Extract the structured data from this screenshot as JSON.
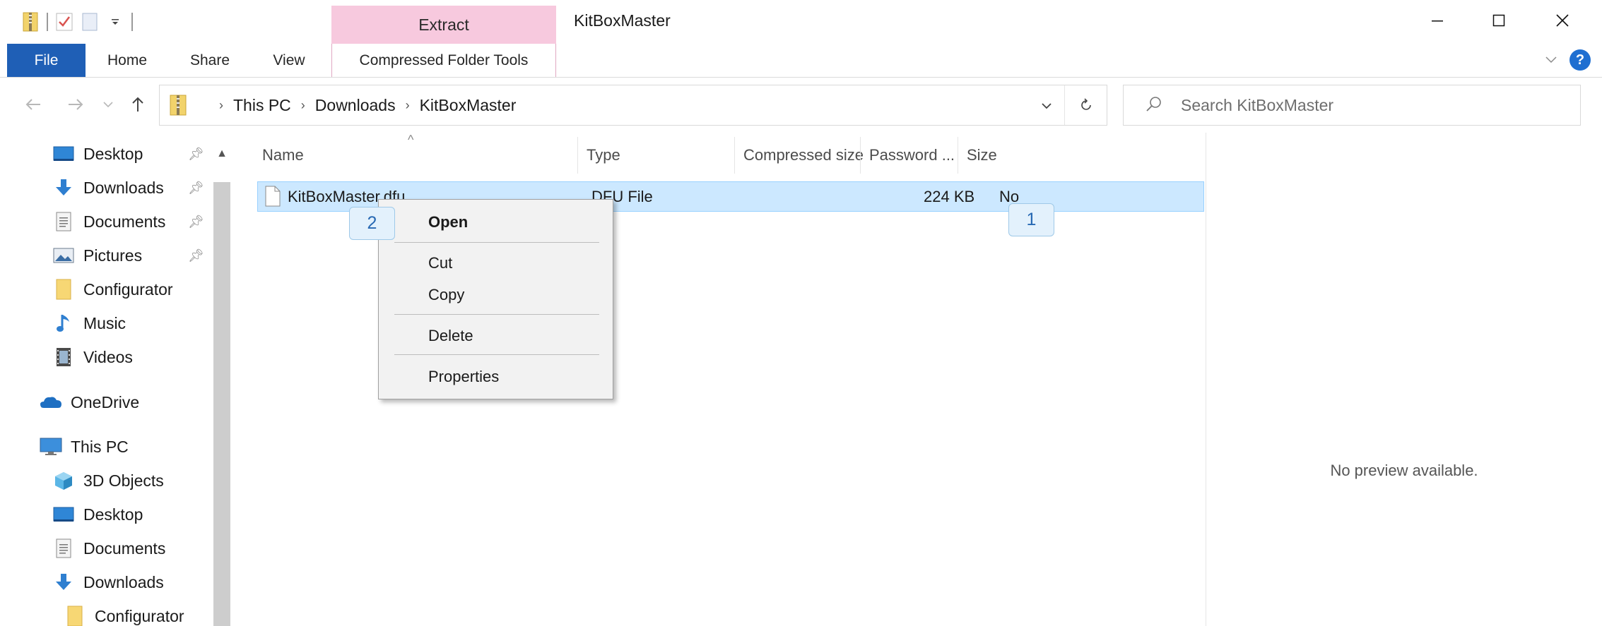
{
  "window": {
    "title": "KitBoxMaster",
    "contextual_tab_header": "Extract",
    "controls": {
      "minimize": "—",
      "maximize": "☐",
      "close": "✕"
    }
  },
  "ribbon": {
    "tabs": [
      {
        "label": "File"
      },
      {
        "label": "Home"
      },
      {
        "label": "Share"
      },
      {
        "label": "View"
      },
      {
        "label": "Compressed Folder Tools"
      }
    ],
    "help": "?"
  },
  "address": {
    "crumbs": [
      "This PC",
      "Downloads",
      "KitBoxMaster"
    ],
    "search_placeholder": "Search KitBoxMaster"
  },
  "nav_pane": {
    "quick_access": [
      {
        "label": "Desktop",
        "icon": "desktop-icon",
        "pinned": true
      },
      {
        "label": "Downloads",
        "icon": "downloads-icon",
        "pinned": true
      },
      {
        "label": "Documents",
        "icon": "documents-icon",
        "pinned": true
      },
      {
        "label": "Pictures",
        "icon": "pictures-icon",
        "pinned": true
      },
      {
        "label": "Configurator",
        "icon": "folder-icon",
        "pinned": false
      },
      {
        "label": "Music",
        "icon": "music-icon",
        "pinned": false
      },
      {
        "label": "Videos",
        "icon": "videos-icon",
        "pinned": false
      }
    ],
    "onedrive": "OneDrive",
    "this_pc": "This PC",
    "this_pc_children": [
      {
        "label": "3D Objects",
        "icon": "3d-objects-icon"
      },
      {
        "label": "Desktop",
        "icon": "desktop-icon"
      },
      {
        "label": "Documents",
        "icon": "documents-icon"
      },
      {
        "label": "Downloads",
        "icon": "downloads-icon"
      },
      {
        "label": "Configurator",
        "icon": "folder-icon"
      }
    ]
  },
  "file_list": {
    "columns": [
      "Name",
      "Type",
      "Compressed size",
      "Password ...",
      "Size"
    ],
    "rows": [
      {
        "name": "KitBoxMaster.dfu",
        "type": "DFU File",
        "compressed_size": "224 KB",
        "password": "No",
        "size": ""
      }
    ]
  },
  "context_menu": {
    "items": [
      "Open",
      "Cut",
      "Copy",
      "Delete",
      "Properties"
    ]
  },
  "callouts": [
    "1",
    "2"
  ],
  "preview": {
    "message": "No preview available."
  },
  "colors": {
    "file_tab": "#1f5fb6",
    "extract_tab": "#f7c9de",
    "selection": "#cce8ff",
    "callout_text": "#2869b3"
  }
}
